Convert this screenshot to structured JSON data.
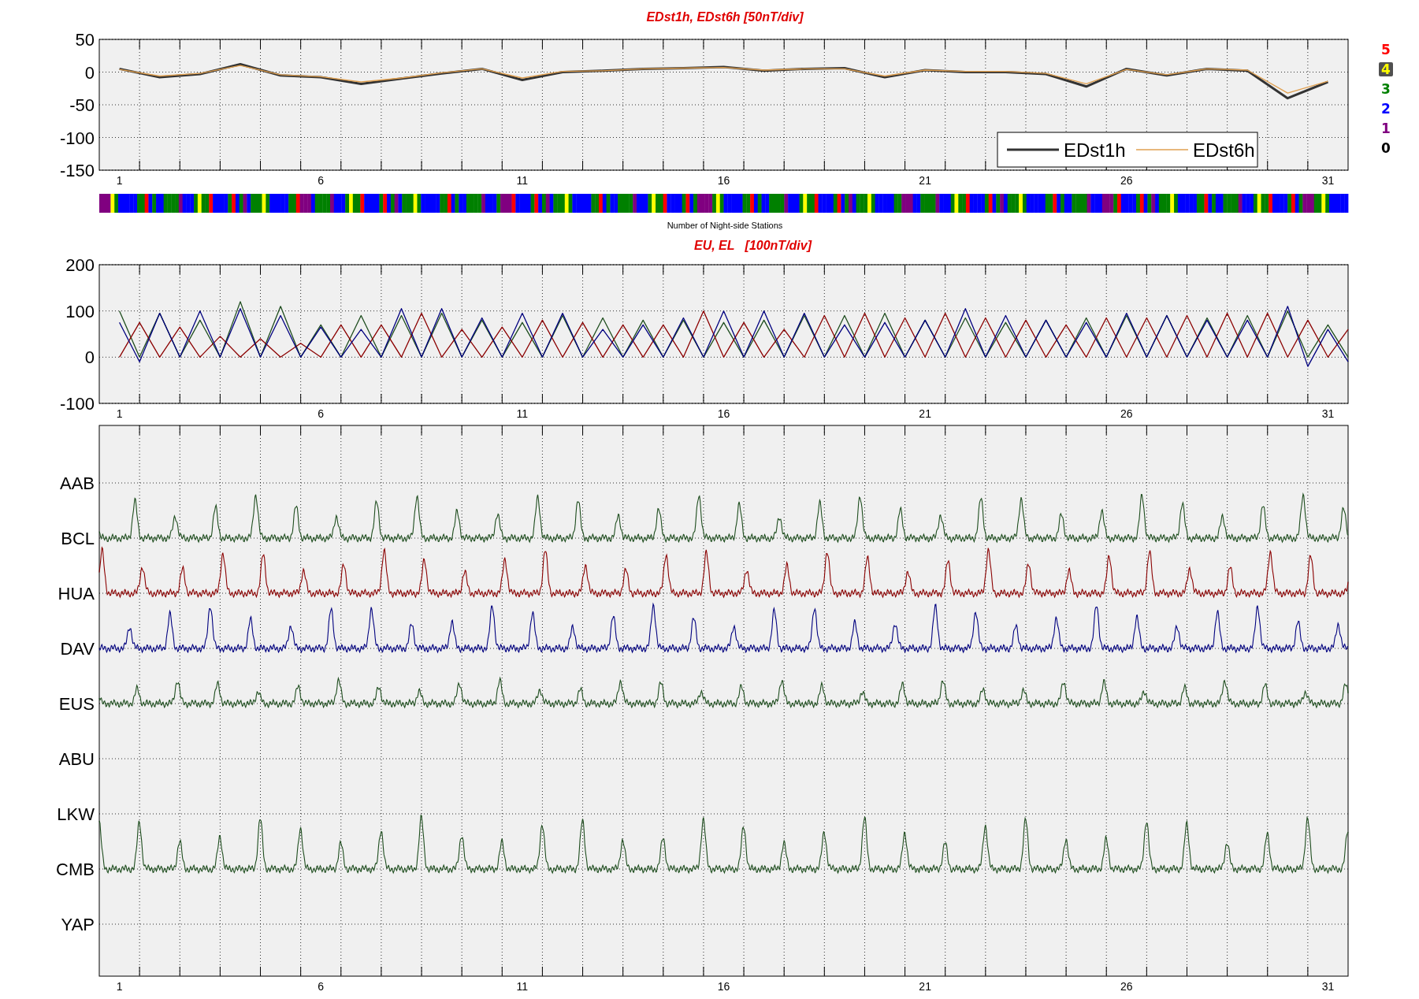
{
  "top_panel": {
    "chart_data": {
      "type": "line",
      "title": "EDst1h, EDst6h [50nT/div]",
      "grid": true,
      "legend": true,
      "x": [
        1,
        2,
        3,
        4,
        5,
        6,
        7,
        8,
        9,
        10,
        11,
        12,
        13,
        14,
        15,
        16,
        17,
        18,
        19,
        20,
        21,
        22,
        23,
        24,
        25,
        26,
        27,
        28,
        29,
        30,
        31
      ],
      "xlim": [
        0.5,
        31.5
      ],
      "ylim": [
        -150,
        50
      ],
      "yticks": [
        50,
        0,
        -50,
        -100,
        -150
      ],
      "xticks": [
        1,
        6,
        11,
        16,
        21,
        26,
        31
      ],
      "series": [
        {
          "name": "EDst1h",
          "color": "#333333",
          "values": [
            5,
            -8,
            -3,
            12,
            -5,
            -8,
            -18,
            -10,
            -2,
            5,
            -12,
            0,
            2,
            5,
            6,
            8,
            2,
            5,
            6,
            -8,
            3,
            0,
            0,
            -3,
            -22,
            5,
            -5,
            5,
            2,
            -40,
            -15
          ]
        },
        {
          "name": "EDst6h",
          "color": "#e0a050",
          "values": [
            4,
            -6,
            -2,
            10,
            -4,
            -7,
            -15,
            -9,
            -1,
            5,
            -9,
            1,
            2,
            5,
            6,
            7,
            3,
            5,
            5,
            -6,
            3,
            1,
            1,
            -2,
            -18,
            4,
            -4,
            5,
            3,
            -32,
            -14
          ]
        }
      ]
    },
    "color_bar": {
      "caption": "Number of Night-side Stations"
    },
    "scale": [
      {
        "label": "5",
        "color": "#ff0000"
      },
      {
        "label": "4",
        "color": "#ffff00"
      },
      {
        "label": "3",
        "color": "#008000"
      },
      {
        "label": "2",
        "color": "#0000ff"
      },
      {
        "label": "1",
        "color": "#800080"
      },
      {
        "label": "0",
        "color": "#000000"
      }
    ]
  },
  "middle_panel": {
    "chart_data": {
      "type": "line",
      "title": "EU, EL   [100nT/div]",
      "grid": true,
      "x": [
        1,
        1.5,
        2,
        2.5,
        3,
        3.5,
        4,
        4.5,
        5,
        5.5,
        6,
        6.5,
        7,
        7.5,
        8,
        8.5,
        9,
        9.5,
        10,
        10.5,
        11,
        11.5,
        12,
        12.5,
        13,
        13.5,
        14,
        14.5,
        15,
        15.5,
        16,
        16.5,
        17,
        17.5,
        18,
        18.5,
        19,
        19.5,
        20,
        20.5,
        21,
        21.5,
        22,
        22.5,
        23,
        23.5,
        24,
        24.5,
        25,
        25.5,
        26,
        26.5,
        27,
        27.5,
        28,
        28.5,
        29,
        29.5,
        30,
        30.5,
        31,
        31.5
      ],
      "xlim": [
        0.5,
        31.5
      ],
      "ylim": [
        -100,
        200
      ],
      "yticks": [
        200,
        100,
        0,
        -100
      ],
      "xticks": [
        1,
        6,
        11,
        16,
        21,
        26,
        31
      ],
      "series": [
        {
          "color": "#1e4d1e",
          "values": [
            100,
            0,
            95,
            0,
            80,
            0,
            120,
            0,
            110,
            0,
            70,
            0,
            90,
            0,
            90,
            0,
            95,
            0,
            80,
            0,
            75,
            0,
            90,
            0,
            85,
            0,
            80,
            0,
            80,
            0,
            75,
            0,
            80,
            0,
            90,
            0,
            90,
            0,
            95,
            0,
            80,
            0,
            85,
            0,
            75,
            0,
            80,
            0,
            85,
            0,
            90,
            0,
            90,
            0,
            85,
            0,
            90,
            0,
            100,
            0,
            70,
            0
          ]
        },
        {
          "color": "#8b0000",
          "values": [
            0,
            75,
            0,
            65,
            0,
            45,
            0,
            40,
            0,
            30,
            0,
            70,
            0,
            70,
            0,
            95,
            0,
            60,
            0,
            65,
            0,
            80,
            0,
            75,
            0,
            70,
            0,
            70,
            0,
            100,
            0,
            75,
            0,
            60,
            0,
            90,
            0,
            95,
            0,
            85,
            0,
            95,
            0,
            85,
            0,
            80,
            0,
            70,
            0,
            85,
            0,
            85,
            0,
            90,
            0,
            95,
            0,
            95,
            0,
            80,
            0,
            60
          ]
        },
        {
          "color": "#00007f",
          "values": [
            75,
            -10,
            95,
            0,
            100,
            0,
            105,
            0,
            90,
            0,
            65,
            0,
            60,
            0,
            105,
            0,
            105,
            0,
            85,
            0,
            95,
            0,
            95,
            0,
            60,
            0,
            70,
            0,
            85,
            0,
            100,
            0,
            100,
            0,
            95,
            0,
            70,
            0,
            75,
            0,
            80,
            0,
            105,
            0,
            90,
            0,
            80,
            0,
            75,
            0,
            95,
            0,
            90,
            0,
            80,
            0,
            80,
            0,
            110,
            -20,
            60,
            -10
          ]
        }
      ]
    }
  },
  "bottom_panel": {
    "x_ticks": [
      "1",
      "6",
      "11",
      "16",
      "21",
      "26",
      "31"
    ],
    "stations": [
      {
        "label": "AAB"
      },
      {
        "label": "BCL",
        "color": "#1e4d1e"
      },
      {
        "label": "HUA",
        "color": "#8b0000"
      },
      {
        "label": "DAV",
        "color": "#00007f"
      },
      {
        "label": "EUS",
        "color": "#1e4d1e"
      },
      {
        "label": "ABU"
      },
      {
        "label": "LKW"
      },
      {
        "label": "CMB",
        "color": "#1e4d1e"
      },
      {
        "label": "YAP"
      }
    ]
  }
}
